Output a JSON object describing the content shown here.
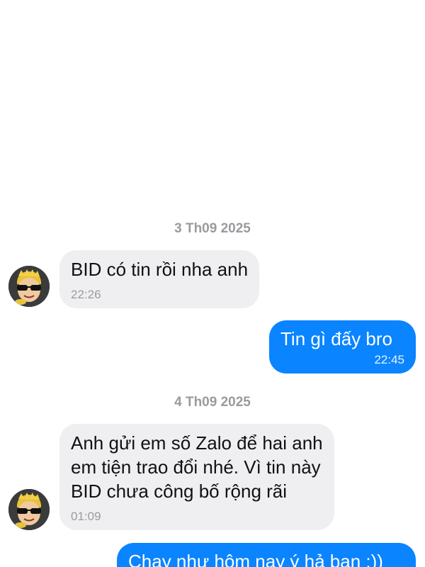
{
  "conversation": {
    "groups": [
      {
        "date": "3 Th09 2025",
        "messages": [
          {
            "direction": "in",
            "text": "BID có tin rồi nha anh",
            "time": "22:26"
          },
          {
            "direction": "out",
            "text": "Tin gì đấy bro",
            "time": "22:45"
          }
        ]
      },
      {
        "date": "4 Th09 2025",
        "messages": [
          {
            "direction": "in",
            "lines": [
              "Anh gửi em số Zalo để hai anh",
              "em tiện trao đổi nhé. Vì tin này",
              "BID chưa công bố rộng rãi"
            ],
            "time": "01:09"
          },
          {
            "direction": "out",
            "text": "Chạy như hôm nay ý hả bạn :))"
          }
        ]
      }
    ]
  },
  "colors": {
    "incoming_bubble": "#efeff1",
    "outgoing_bubble": "#0a84ff",
    "date_separator": "#9a9a9f"
  },
  "icons": {
    "avatar": "cartoon-face-with-sunglasses-avatar"
  }
}
